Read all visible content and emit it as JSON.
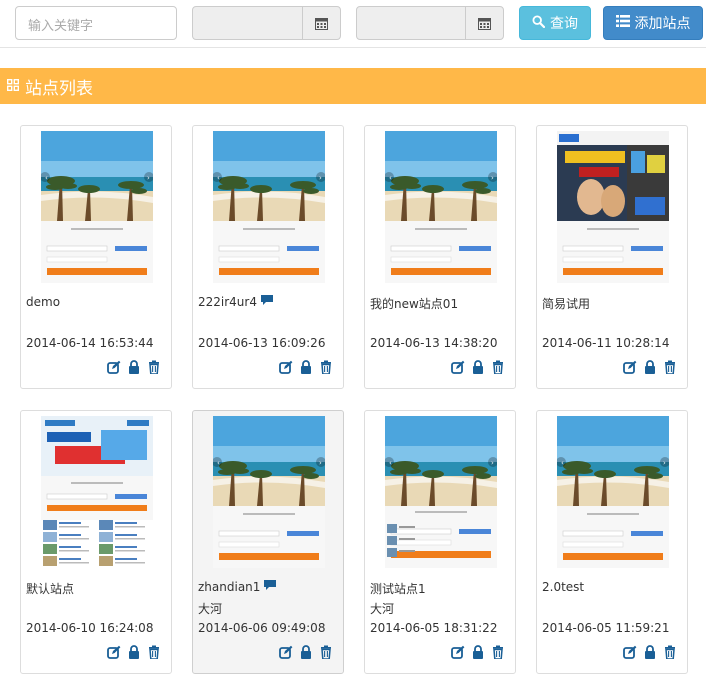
{
  "toolbar": {
    "search_placeholder": "输入关键字",
    "query_label": "查询",
    "add_label": "添加站点"
  },
  "section": {
    "title": "站点列表"
  },
  "sites": [
    {
      "name": "demo",
      "owner": "",
      "date": "2014-06-14 16:53:44",
      "has_comment": false,
      "thumb": "beach"
    },
    {
      "name": "222ir4ur4",
      "owner": "",
      "date": "2014-06-13 16:09:26",
      "has_comment": true,
      "thumb": "beach"
    },
    {
      "name": "我的new站点01",
      "owner": "",
      "date": "2014-06-13 14:38:20",
      "has_comment": false,
      "thumb": "beach"
    },
    {
      "name": "简易试用",
      "owner": "",
      "date": "2014-06-11 10:28:14",
      "has_comment": false,
      "thumb": "promo"
    },
    {
      "name": "默认站点",
      "owner": "",
      "date": "2014-06-10 16:24:08",
      "has_comment": false,
      "thumb": "list"
    },
    {
      "name": "zhandian1",
      "owner": "大河",
      "date": "2014-06-06 09:49:08",
      "has_comment": true,
      "thumb": "beach",
      "highlighted": true
    },
    {
      "name": "测试站点1",
      "owner": "大河",
      "date": "2014-06-05 18:31:22",
      "has_comment": false,
      "thumb": "beach-list"
    },
    {
      "name": "2.0test",
      "owner": "",
      "date": "2014-06-05 11:59:21",
      "has_comment": false,
      "thumb": "beach"
    }
  ],
  "colors": {
    "header_bar": "#ffb848",
    "query_button": "#5bc0de",
    "add_button": "#428bca",
    "action_icon": "#1a5f96",
    "login_button": "#f07d1a"
  }
}
